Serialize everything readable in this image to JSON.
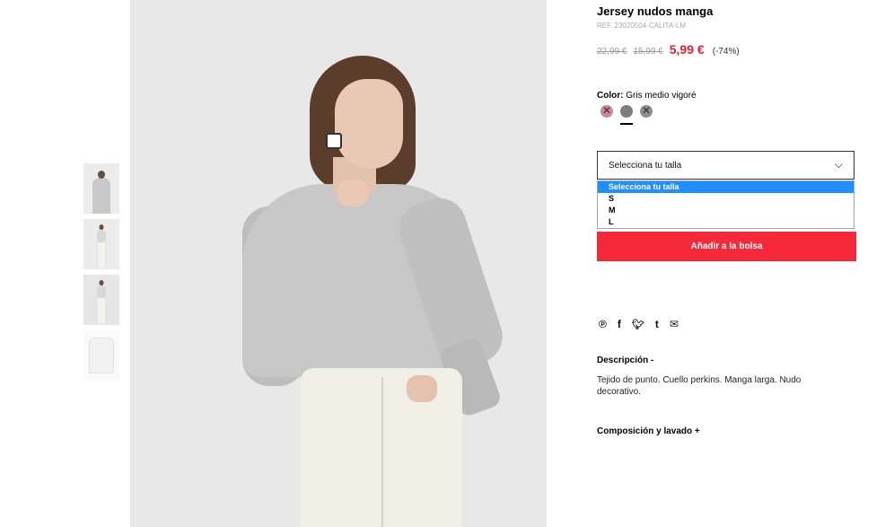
{
  "product": {
    "title": "Jersey nudos manga",
    "ref": "REF. 23020504-CALITA-LM",
    "price_original": "22,99 €",
    "price_previous": "15,99 €",
    "price_current": "5,99 €",
    "discount": "(-74%)"
  },
  "color": {
    "label": "Color:",
    "value": "Gris medio vigoré",
    "swatches": [
      {
        "name": "rosa",
        "hex": "#c98a95",
        "unavailable": true
      },
      {
        "name": "gris medio vigoré",
        "hex": "#7a7d7d",
        "unavailable": false,
        "selected": true
      },
      {
        "name": "gris oscuro",
        "hex": "#8f8f8f",
        "unavailable": true
      }
    ]
  },
  "size": {
    "placeholder": "Selecciona tu talla",
    "options": [
      "Selecciona tu talla",
      "S",
      "M",
      "L"
    ],
    "highlighted": "Selecciona tu talla"
  },
  "add_button": "Añadir a la bolsa",
  "social_icons": [
    "pinterest-icon",
    "facebook-icon",
    "twitter-icon",
    "tumblr-icon",
    "email-icon"
  ],
  "social_glyphs": [
    "℗",
    "f",
    "🐦",
    "t",
    "✉"
  ],
  "description": {
    "title": "Descripción -",
    "text": "Tejido de punto. Cuello perkins. Manga larga. Nudo decorativo."
  },
  "composition_title": "Composición y lavado +",
  "colors": {
    "accent_red": "#e0212e",
    "button_red": "#f5293a",
    "select_highlight": "#1e90ff"
  }
}
